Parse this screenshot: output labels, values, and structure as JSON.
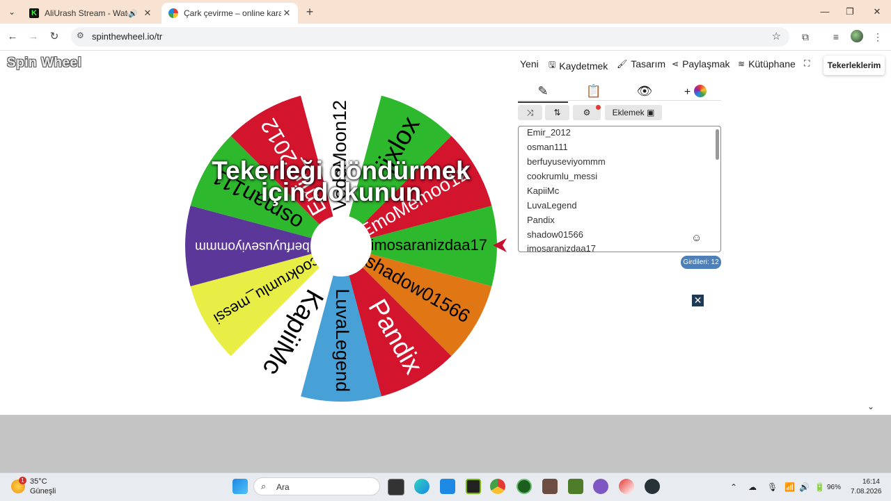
{
  "browser": {
    "tabs": [
      {
        "title": "AliUrash Stream - Watch Live",
        "active": false,
        "audio": true
      },
      {
        "title": "Çark çevirme – online karar çarkı",
        "active": true,
        "audio": false
      }
    ],
    "url": "spinthewheel.io/tr"
  },
  "page": {
    "logo": "Spin Wheel",
    "menu": [
      {
        "label": "Yeni",
        "icon": ""
      },
      {
        "label": "Kaydetmek",
        "icon": "save-icon"
      },
      {
        "label": "Tasarım",
        "icon": "paint-roller-icon"
      },
      {
        "label": "Paylaşmak",
        "icon": "share-icon"
      },
      {
        "label": "Kütüphane",
        "icon": "layers-icon"
      }
    ],
    "my_wheels": "Tekerleklerim",
    "wheel_overlay": "Tekerleği döndürmek için dokunun",
    "add_button": "Eklemek",
    "entries": [
      "Emir_2012",
      "osman111",
      "berfuyuseviyommm",
      "cookrumlu_messi",
      "KapiiMc",
      "LuvaLegend",
      "Pandix",
      "shadow01566",
      "imosaranizdaa17"
    ],
    "entries_count": "Girdileri: 12"
  },
  "wheel": {
    "segments": [
      {
        "label": "imosaranizdaa17",
        "color": "#2eb82e",
        "text_color": "#000000"
      },
      {
        "label": "shadow01566",
        "color": "#e07614",
        "text_color": "#000000"
      },
      {
        "label": "Pandix",
        "color": "#d2142c",
        "text_color": "#ffffff"
      },
      {
        "label": "LuvaLegend",
        "color": "#47a0d6",
        "text_color": "#000000"
      },
      {
        "label": "KapiiMc",
        "color": "#ffffff",
        "text_color": "#000000"
      },
      {
        "label": "cookrumlu_messi",
        "color": "#e9ee46",
        "text_color": "#000000"
      },
      {
        "label": "berfuyuseviyommm",
        "color": "#5b3799",
        "text_color": "#ffffff"
      },
      {
        "label": "osman111",
        "color": "#2eb82e",
        "text_color": "#000000"
      },
      {
        "label": "Emir_2012",
        "color": "#d2142c",
        "text_color": "#ffffff"
      },
      {
        "label": "VeddMoon12",
        "color": "#ffffff",
        "text_color": "#000000"
      },
      {
        "label": "jixlox",
        "color": "#2eb82e",
        "text_color": "#000000"
      },
      {
        "label": "EmoMemoo12",
        "color": "#d2142c",
        "text_color": "#ffffff"
      }
    ],
    "pointer_color": "#c8102e"
  },
  "taskbar": {
    "temperature": "35°C",
    "condition": "Güneşli",
    "weather_badge": "1",
    "search_placeholder": "Ara",
    "battery": "96%",
    "time": "16:14",
    "date": "7.08.2026"
  }
}
